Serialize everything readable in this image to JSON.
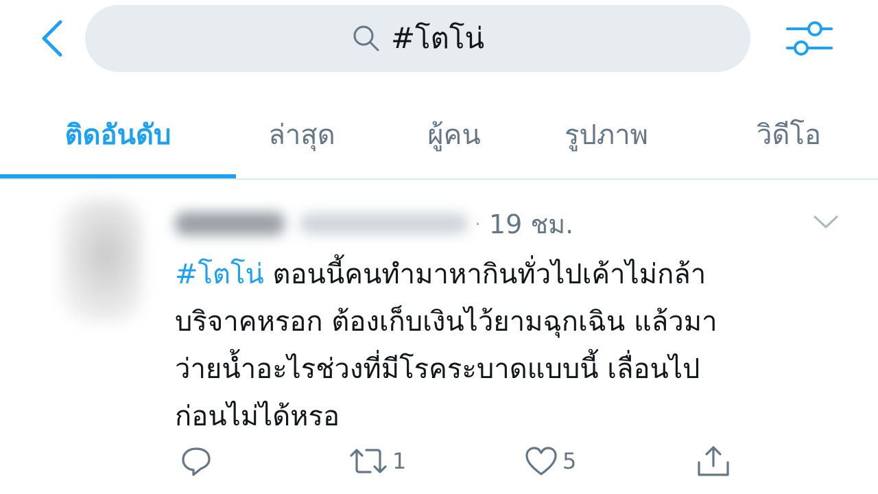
{
  "search": {
    "query": "#โตโน่"
  },
  "tabs": [
    {
      "label": "ติดอันดับ",
      "active": true
    },
    {
      "label": "ล่าสุด",
      "active": false
    },
    {
      "label": "ผู้คน",
      "active": false
    },
    {
      "label": "รูปภาพ",
      "active": false
    },
    {
      "label": "วิดีโอ",
      "active": false
    }
  ],
  "tweet": {
    "meta_separator": "·",
    "time": "19 ชม.",
    "hashtag": "#โตโน่",
    "text_line1": " ตอนนี้คนทำมาหากินทั่วไปเค้าไม่กล้า",
    "text_line2": "บริจาคหรอก ต้องเก็บเงินไว้ยามฉุกเฉิน แล้วมา",
    "text_line3": "ว่ายน้ำอะไรช่วงที่มีโรคระบาดแบบนี้ เลื่อนไป",
    "text_line4": "ก่อนไม่ได้หรอ",
    "retweet_count": "1",
    "like_count": "5"
  },
  "icons": {
    "back": "chevron-left-icon",
    "search": "search-icon",
    "filter": "sliders-icon",
    "caret": "chevron-down-icon",
    "reply": "reply-icon",
    "retweet": "retweet-icon",
    "like": "heart-icon",
    "share": "share-icon"
  },
  "colors": {
    "accent": "#1da1f2",
    "text_primary": "#14171a",
    "text_secondary": "#657786",
    "search_background": "#e6ecf0"
  }
}
